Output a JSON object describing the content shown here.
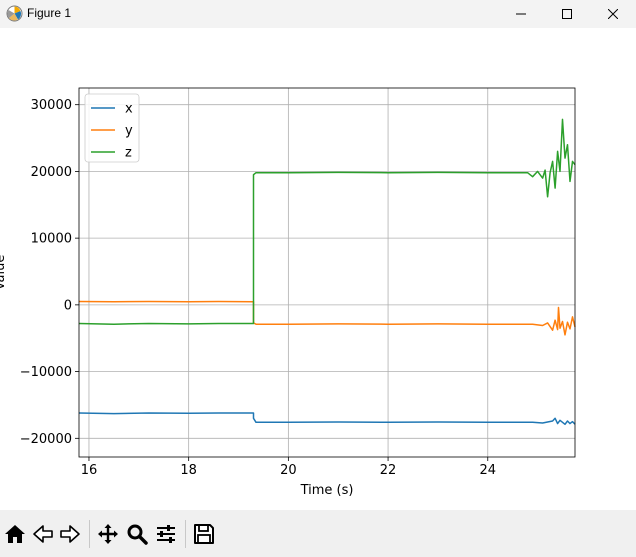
{
  "window": {
    "title": "Figure 1",
    "controls": [
      "minimize",
      "maximize",
      "close"
    ]
  },
  "toolbar": {
    "icons": [
      "home-icon",
      "back-arrow-icon",
      "forward-arrow-icon",
      "pan-icon",
      "zoom-icon",
      "configure-subplots-icon",
      "save-icon"
    ]
  },
  "chart_data": {
    "type": "line",
    "title": "",
    "xlabel": "Time (s)",
    "ylabel": "Value",
    "xlim": [
      15.8,
      25.75
    ],
    "ylim": [
      -22800,
      32500
    ],
    "xticks": [
      16,
      18,
      20,
      22,
      24
    ],
    "xtick_labels": [
      "16",
      "18",
      "20",
      "22",
      "24"
    ],
    "yticks": [
      -20000,
      -10000,
      0,
      10000,
      20000,
      30000
    ],
    "ytick_labels": [
      "−20000",
      "−10000",
      "0",
      "10000",
      "20000",
      "30000"
    ],
    "grid": true,
    "legend": {
      "placement": "upper-left",
      "entries": [
        "x",
        "y",
        "z"
      ]
    },
    "series": [
      {
        "name": "x",
        "color": "#1f77b4",
        "x": [
          15.8,
          16.5,
          17.2,
          18.0,
          18.6,
          19.3,
          19.3,
          19.35,
          20.0,
          21.0,
          22.0,
          23.0,
          24.0,
          24.9,
          25.1,
          25.2,
          25.3,
          25.35,
          25.4,
          25.45,
          25.5,
          25.55,
          25.6,
          25.65,
          25.7,
          25.75
        ],
        "y": [
          -16200,
          -16300,
          -16200,
          -16250,
          -16200,
          -16200,
          -17000,
          -17600,
          -17600,
          -17550,
          -17600,
          -17550,
          -17600,
          -17600,
          -17700,
          -17550,
          -17400,
          -17000,
          -17800,
          -17300,
          -17600,
          -17900,
          -17400,
          -17800,
          -17500,
          -17900
        ]
      },
      {
        "name": "y",
        "color": "#ff7f0e",
        "x": [
          15.8,
          16.5,
          17.2,
          18.0,
          18.6,
          19.3,
          19.3,
          19.35,
          20.0,
          21.0,
          22.0,
          23.0,
          24.0,
          24.9,
          25.1,
          25.2,
          25.3,
          25.35,
          25.4,
          25.42,
          25.45,
          25.5,
          25.55,
          25.6,
          25.65,
          25.7,
          25.75
        ],
        "y": [
          500,
          480,
          500,
          470,
          500,
          480,
          -2700,
          -2900,
          -2900,
          -2850,
          -2900,
          -2850,
          -2900,
          -2900,
          -3100,
          -2700,
          -3800,
          -2300,
          -3700,
          -400,
          -3500,
          -2500,
          -4500,
          -2600,
          -3600,
          -1800,
          -3300
        ]
      },
      {
        "name": "z",
        "color": "#2ca02c",
        "x": [
          15.8,
          16.5,
          17.2,
          18.0,
          18.6,
          19.3,
          19.3,
          19.35,
          20.0,
          21.0,
          22.0,
          23.0,
          24.0,
          24.8,
          24.9,
          25.0,
          25.1,
          25.15,
          25.2,
          25.25,
          25.3,
          25.35,
          25.4,
          25.45,
          25.5,
          25.55,
          25.6,
          25.65,
          25.7,
          25.75
        ],
        "y": [
          -2800,
          -2900,
          -2800,
          -2850,
          -2800,
          -2800,
          19500,
          19800,
          19800,
          19850,
          19800,
          19850,
          19800,
          19800,
          19200,
          20000,
          19000,
          20200,
          16200,
          19800,
          21500,
          17500,
          23000,
          20000,
          27800,
          22000,
          24000,
          18500,
          21500,
          21000
        ]
      }
    ]
  }
}
